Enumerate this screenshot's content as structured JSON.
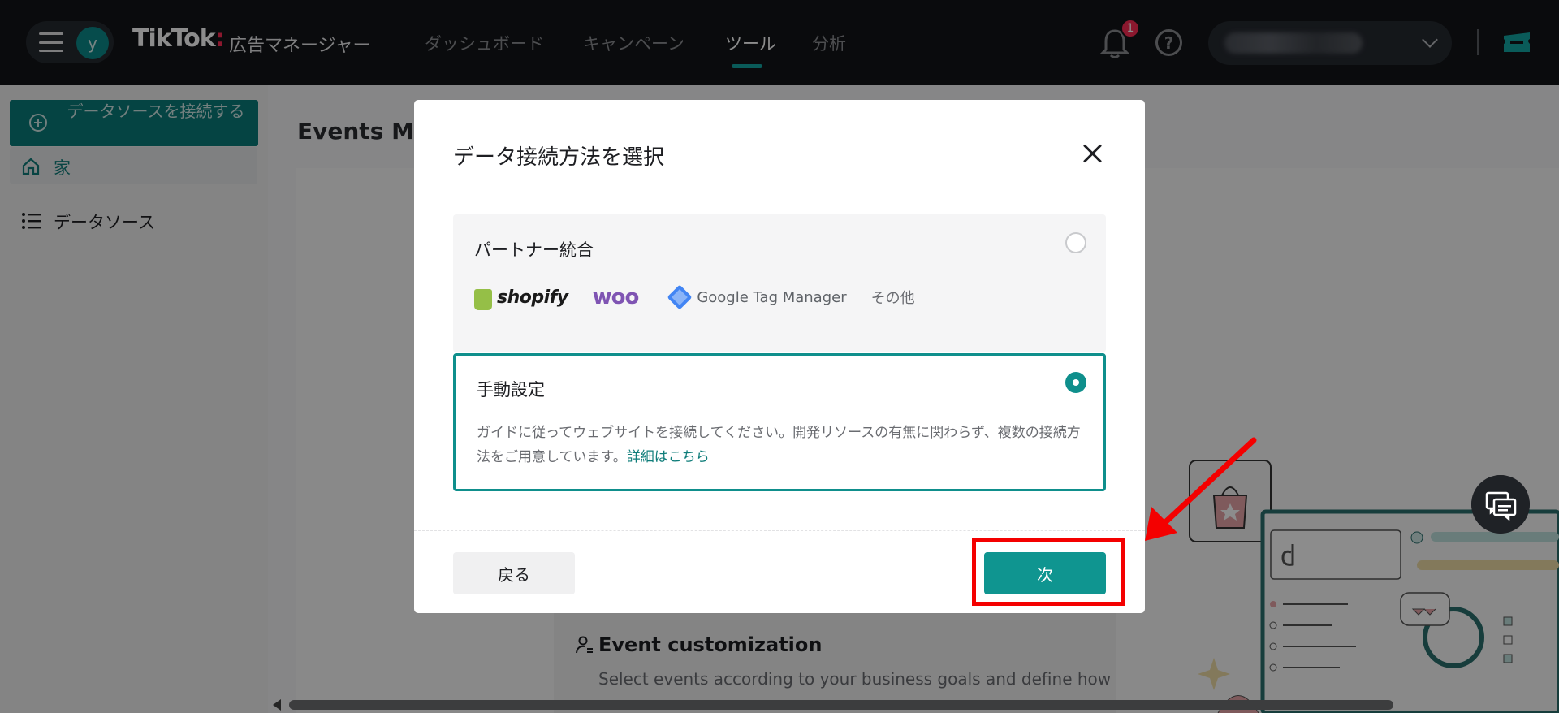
{
  "header": {
    "brand": "TikTok",
    "brand_dot": ":",
    "brand_sub": "広告マネージャー",
    "avatar_letter": "y",
    "nav": [
      "ダッシュボード",
      "キャンペーン",
      "ツール",
      "分析"
    ],
    "active_nav": "ツール",
    "notification_count": "1",
    "help_glyph": "?"
  },
  "sidebar": {
    "connect_label": "データソースを接続する",
    "items": [
      {
        "label": "家",
        "icon": "home-icon"
      },
      {
        "label": "データソース",
        "icon": "list-icon"
      }
    ]
  },
  "main": {
    "title": "Events Ma",
    "event_title": "Event customization",
    "event_desc": "Select events according to your business goals and define how"
  },
  "modal": {
    "title": "データ接続方法を選択",
    "options": [
      {
        "title": "パートナー統合",
        "partners": [
          "shopify",
          "woo",
          "Google Tag Manager",
          "その他"
        ],
        "selected": false
      },
      {
        "title": "手動設定",
        "description": "ガイドに従ってウェブサイトを接続してください。開発リソースの有無に関わらず、複数の接続方法をご用意しています。",
        "link": "詳細はこちら",
        "selected": true
      }
    ],
    "back_label": "戻る",
    "next_label": "次"
  },
  "colors": {
    "accent": "#0f9590",
    "topbar": "#131519",
    "annotation": "#f40000",
    "badge": "#fe2c55"
  }
}
